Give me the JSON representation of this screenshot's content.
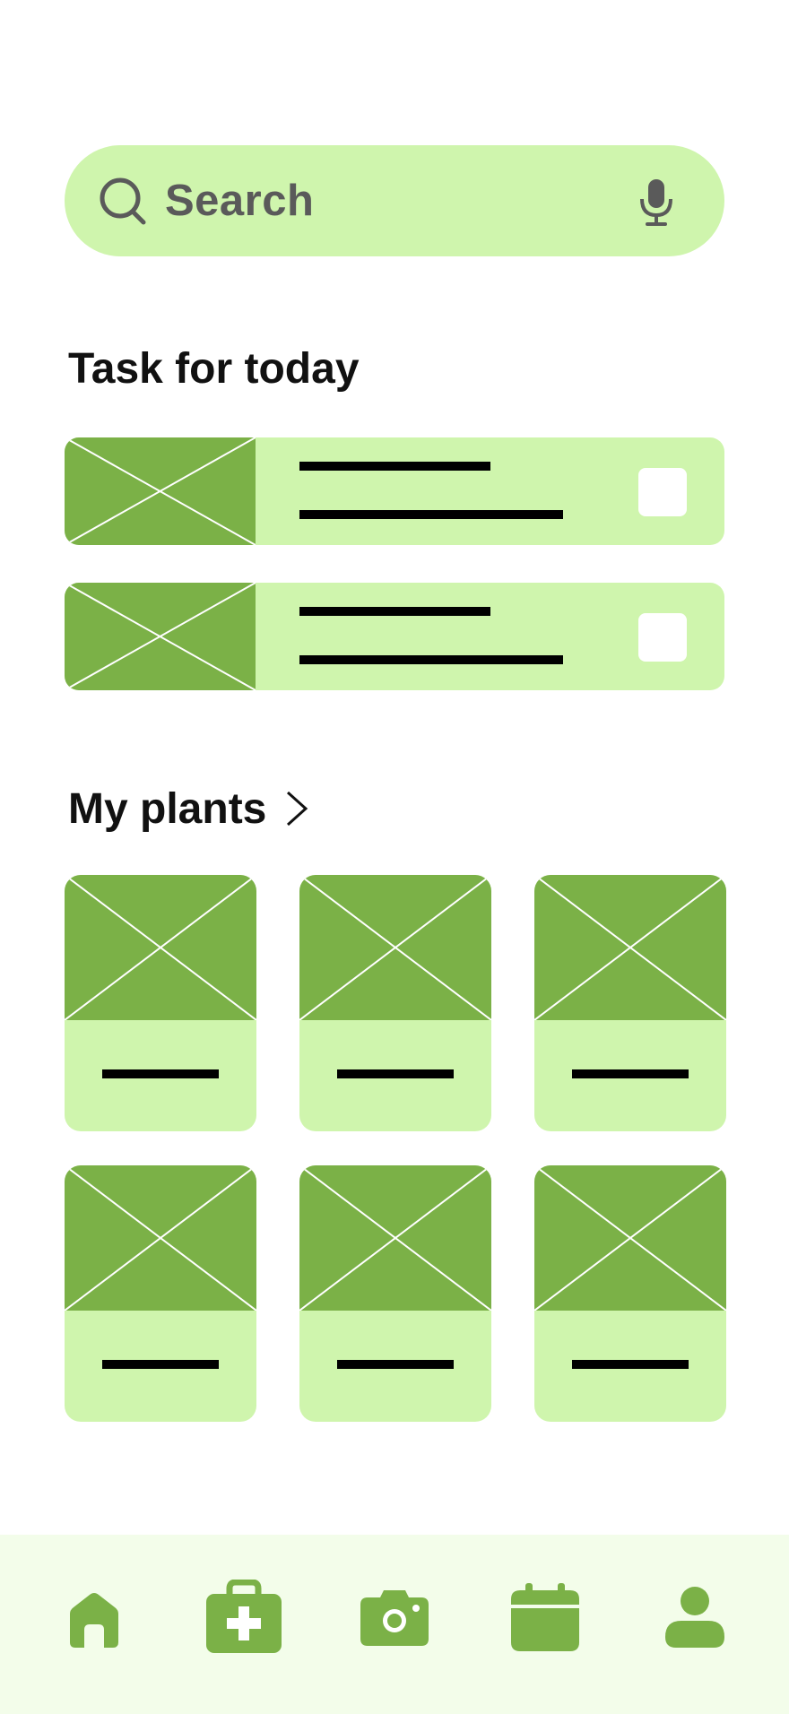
{
  "search": {
    "placeholder": "Search"
  },
  "tasks": {
    "title": "Task for today",
    "items": [
      {
        "checked": false
      },
      {
        "checked": false
      }
    ]
  },
  "plants": {
    "title": "My plants",
    "items": [
      {},
      {},
      {},
      {},
      {},
      {}
    ]
  },
  "bottom_nav": {
    "items": [
      {
        "icon": "home-icon"
      },
      {
        "icon": "first-aid-kit-icon"
      },
      {
        "icon": "camera-icon"
      },
      {
        "icon": "calendar-icon"
      },
      {
        "icon": "profile-icon"
      }
    ]
  },
  "colors": {
    "accent_dark": "#7bb147",
    "accent_light": "#cff5ad",
    "nav_background": "#f3fdea"
  }
}
